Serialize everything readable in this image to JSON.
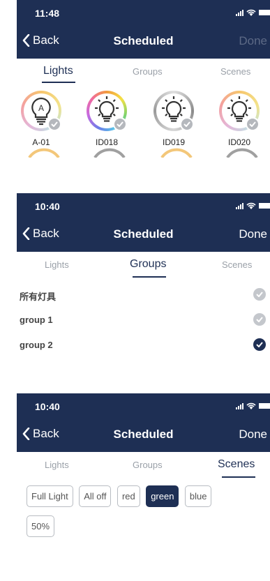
{
  "panels": [
    {
      "status": {
        "time": "11:48"
      },
      "nav": {
        "back_label": "Back",
        "title": "Scheduled",
        "done_label": "Done",
        "done_enabled": false
      },
      "tabs": [
        {
          "label": "Lights",
          "active": true
        },
        {
          "label": "Groups",
          "active": false
        },
        {
          "label": "Scenes",
          "active": false
        }
      ],
      "lights": [
        {
          "label": "A-01",
          "icon": "letter-bulb-icon",
          "letter": "A",
          "selected": false
        },
        {
          "label": "ID018",
          "icon": "bulb-icon",
          "selected": false
        },
        {
          "label": "ID019",
          "icon": "bulb-icon",
          "selected": false
        },
        {
          "label": "ID020",
          "icon": "bulb-icon",
          "selected": false
        }
      ]
    },
    {
      "status": {
        "time": "10:40"
      },
      "nav": {
        "back_label": "Back",
        "title": "Scheduled",
        "done_label": "Done",
        "done_enabled": true
      },
      "tabs": [
        {
          "label": "Lights",
          "active": false
        },
        {
          "label": "Groups",
          "active": true
        },
        {
          "label": "Scenes",
          "active": false
        }
      ],
      "groups": [
        {
          "label": "所有灯具",
          "selected": false
        },
        {
          "label": "group 1",
          "selected": false
        },
        {
          "label": "group 2",
          "selected": true
        }
      ]
    },
    {
      "status": {
        "time": "10:40"
      },
      "nav": {
        "back_label": "Back",
        "title": "Scheduled",
        "done_label": "Done",
        "done_enabled": true
      },
      "tabs": [
        {
          "label": "Lights",
          "active": false
        },
        {
          "label": "Groups",
          "active": false
        },
        {
          "label": "Scenes",
          "active": true
        }
      ],
      "scenes": [
        {
          "label": "Full Light",
          "selected": false
        },
        {
          "label": "All off",
          "selected": false
        },
        {
          "label": "red",
          "selected": false
        },
        {
          "label": "green",
          "selected": true
        },
        {
          "label": "blue",
          "selected": false
        },
        {
          "label": "50%",
          "selected": false
        }
      ]
    }
  ],
  "colors": {
    "navbar": "#1e2f54",
    "accent": "#1e2f54",
    "inactive": "#9aa0a8",
    "check_inactive": "#c4c7cc"
  }
}
